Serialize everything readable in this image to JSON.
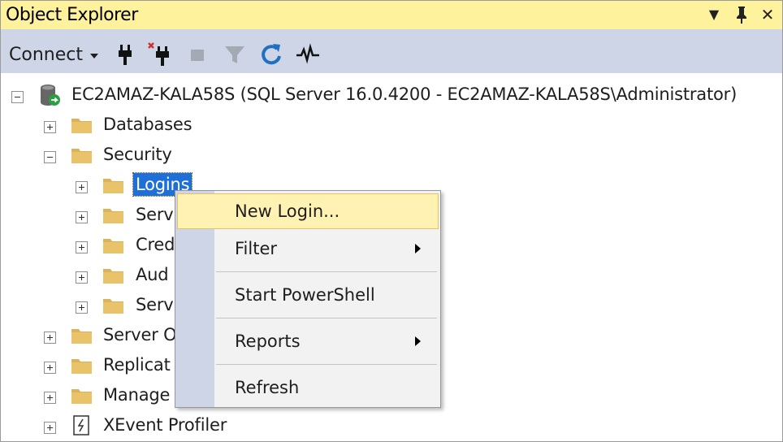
{
  "window": {
    "title": "Object Explorer",
    "buttons": {
      "dropdown": "▼",
      "pin": "📌",
      "close": "✕"
    }
  },
  "toolbar": {
    "connect_label": "Connect",
    "icons": [
      "connect-plug-icon",
      "disconnect-plug-icon",
      "stop-icon",
      "filter-icon",
      "refresh-icon",
      "activity-monitor-icon"
    ]
  },
  "tree": {
    "server": "EC2AMAZ-KALA58S (SQL Server 16.0.4200 - EC2AMAZ-KALA58S\\Administrator)",
    "databases": "Databases",
    "security": "Security",
    "logins": "Logins",
    "security_children": [
      "Serv",
      "Cred",
      "Aud",
      "Serv"
    ],
    "server_objects": "Server O",
    "replication": "Replicat",
    "management": "Manage",
    "xevent": "XEvent Profiler"
  },
  "context_menu": {
    "items": [
      {
        "label": "New Login...",
        "submenu": false
      },
      {
        "label": "Filter",
        "submenu": true
      },
      {
        "label": "Start PowerShell",
        "submenu": false
      },
      {
        "label": "Reports",
        "submenu": true
      },
      {
        "label": "Refresh",
        "submenu": false
      }
    ]
  },
  "colors": {
    "title_bar": "#fff29d",
    "toolbar": "#ced5e6",
    "selection": "#1e6fd6",
    "menu_hover": "#fff2b3",
    "folder": "#dcb35c",
    "refresh_icon": "#1f6fc2"
  }
}
